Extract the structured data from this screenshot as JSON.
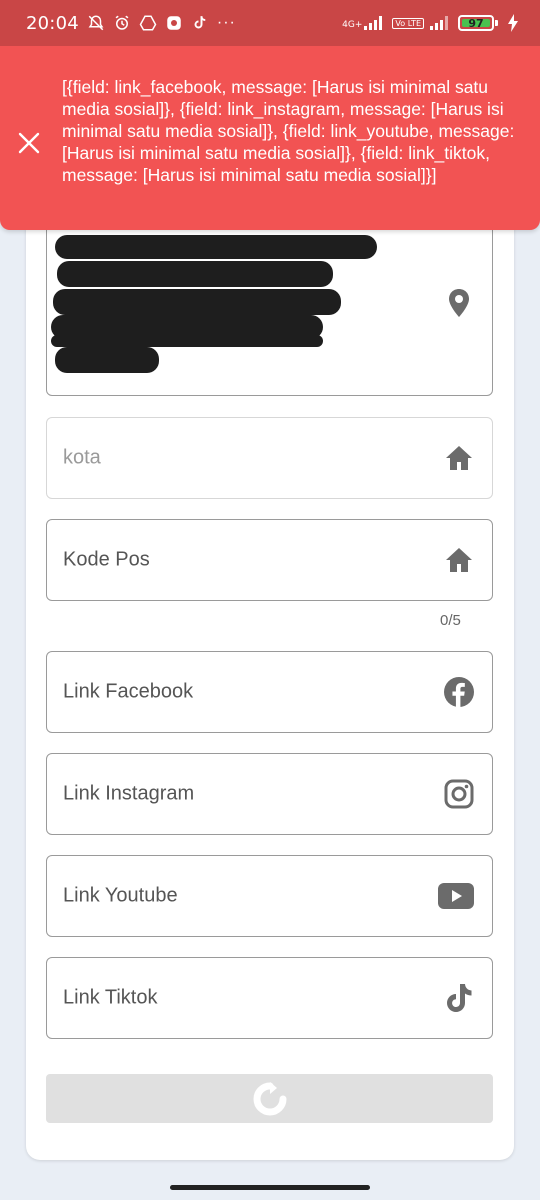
{
  "status_bar": {
    "time": "20:04",
    "network": "4G+",
    "volte": "Vo LTE",
    "battery": "97",
    "more": "···"
  },
  "toast": {
    "message": "[{field: link_facebook, message: [Harus isi minimal satu media sosial]}, {field: link_instagram, message: [Harus isi minimal satu media sosial]}, {field: link_youtube, message: [Harus isi minimal satu media sosial]}, {field: link_tiktok, message: [Harus isi minimal satu media sosial]}]",
    "color": "#f25353"
  },
  "form": {
    "address_icon": "location-pin-icon",
    "kota": {
      "label": "kota",
      "icon": "home-icon",
      "enabled": false
    },
    "kode_pos": {
      "label": "Kode Pos",
      "icon": "home-icon",
      "counter": "0/5"
    },
    "facebook": {
      "label": "Link Facebook",
      "icon": "facebook-icon"
    },
    "instagram": {
      "label": "Link Instagram",
      "icon": "instagram-icon"
    },
    "youtube": {
      "label": "Link Youtube",
      "icon": "youtube-icon"
    },
    "tiktok": {
      "label": "Link Tiktok",
      "icon": "tiktok-icon"
    },
    "submit_icon": "loading-spinner-icon"
  }
}
